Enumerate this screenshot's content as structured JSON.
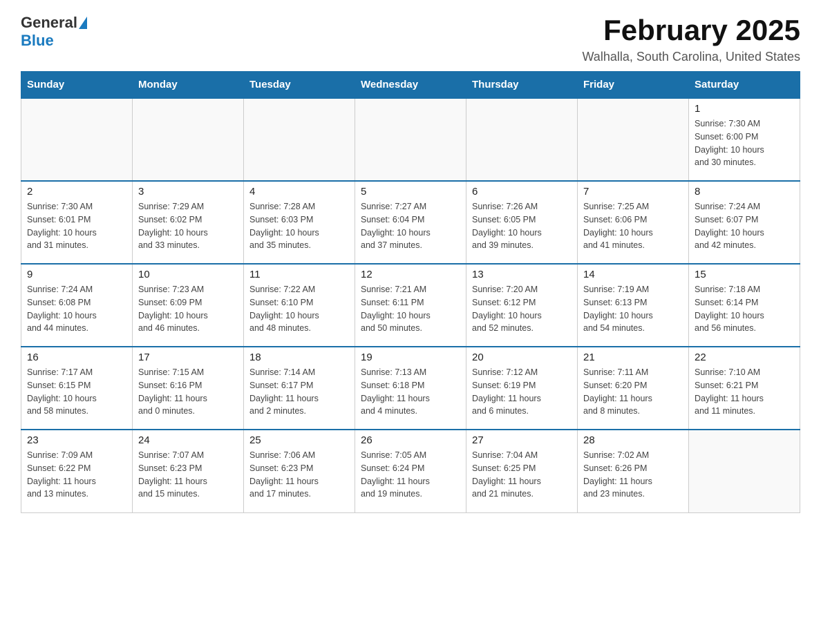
{
  "header": {
    "logo_general": "General",
    "logo_blue": "Blue",
    "month_title": "February 2025",
    "location": "Walhalla, South Carolina, United States"
  },
  "weekdays": [
    "Sunday",
    "Monday",
    "Tuesday",
    "Wednesday",
    "Thursday",
    "Friday",
    "Saturday"
  ],
  "weeks": [
    [
      {
        "day": "",
        "info": ""
      },
      {
        "day": "",
        "info": ""
      },
      {
        "day": "",
        "info": ""
      },
      {
        "day": "",
        "info": ""
      },
      {
        "day": "",
        "info": ""
      },
      {
        "day": "",
        "info": ""
      },
      {
        "day": "1",
        "info": "Sunrise: 7:30 AM\nSunset: 6:00 PM\nDaylight: 10 hours\nand 30 minutes."
      }
    ],
    [
      {
        "day": "2",
        "info": "Sunrise: 7:30 AM\nSunset: 6:01 PM\nDaylight: 10 hours\nand 31 minutes."
      },
      {
        "day": "3",
        "info": "Sunrise: 7:29 AM\nSunset: 6:02 PM\nDaylight: 10 hours\nand 33 minutes."
      },
      {
        "day": "4",
        "info": "Sunrise: 7:28 AM\nSunset: 6:03 PM\nDaylight: 10 hours\nand 35 minutes."
      },
      {
        "day": "5",
        "info": "Sunrise: 7:27 AM\nSunset: 6:04 PM\nDaylight: 10 hours\nand 37 minutes."
      },
      {
        "day": "6",
        "info": "Sunrise: 7:26 AM\nSunset: 6:05 PM\nDaylight: 10 hours\nand 39 minutes."
      },
      {
        "day": "7",
        "info": "Sunrise: 7:25 AM\nSunset: 6:06 PM\nDaylight: 10 hours\nand 41 minutes."
      },
      {
        "day": "8",
        "info": "Sunrise: 7:24 AM\nSunset: 6:07 PM\nDaylight: 10 hours\nand 42 minutes."
      }
    ],
    [
      {
        "day": "9",
        "info": "Sunrise: 7:24 AM\nSunset: 6:08 PM\nDaylight: 10 hours\nand 44 minutes."
      },
      {
        "day": "10",
        "info": "Sunrise: 7:23 AM\nSunset: 6:09 PM\nDaylight: 10 hours\nand 46 minutes."
      },
      {
        "day": "11",
        "info": "Sunrise: 7:22 AM\nSunset: 6:10 PM\nDaylight: 10 hours\nand 48 minutes."
      },
      {
        "day": "12",
        "info": "Sunrise: 7:21 AM\nSunset: 6:11 PM\nDaylight: 10 hours\nand 50 minutes."
      },
      {
        "day": "13",
        "info": "Sunrise: 7:20 AM\nSunset: 6:12 PM\nDaylight: 10 hours\nand 52 minutes."
      },
      {
        "day": "14",
        "info": "Sunrise: 7:19 AM\nSunset: 6:13 PM\nDaylight: 10 hours\nand 54 minutes."
      },
      {
        "day": "15",
        "info": "Sunrise: 7:18 AM\nSunset: 6:14 PM\nDaylight: 10 hours\nand 56 minutes."
      }
    ],
    [
      {
        "day": "16",
        "info": "Sunrise: 7:17 AM\nSunset: 6:15 PM\nDaylight: 10 hours\nand 58 minutes."
      },
      {
        "day": "17",
        "info": "Sunrise: 7:15 AM\nSunset: 6:16 PM\nDaylight: 11 hours\nand 0 minutes."
      },
      {
        "day": "18",
        "info": "Sunrise: 7:14 AM\nSunset: 6:17 PM\nDaylight: 11 hours\nand 2 minutes."
      },
      {
        "day": "19",
        "info": "Sunrise: 7:13 AM\nSunset: 6:18 PM\nDaylight: 11 hours\nand 4 minutes."
      },
      {
        "day": "20",
        "info": "Sunrise: 7:12 AM\nSunset: 6:19 PM\nDaylight: 11 hours\nand 6 minutes."
      },
      {
        "day": "21",
        "info": "Sunrise: 7:11 AM\nSunset: 6:20 PM\nDaylight: 11 hours\nand 8 minutes."
      },
      {
        "day": "22",
        "info": "Sunrise: 7:10 AM\nSunset: 6:21 PM\nDaylight: 11 hours\nand 11 minutes."
      }
    ],
    [
      {
        "day": "23",
        "info": "Sunrise: 7:09 AM\nSunset: 6:22 PM\nDaylight: 11 hours\nand 13 minutes."
      },
      {
        "day": "24",
        "info": "Sunrise: 7:07 AM\nSunset: 6:23 PM\nDaylight: 11 hours\nand 15 minutes."
      },
      {
        "day": "25",
        "info": "Sunrise: 7:06 AM\nSunset: 6:23 PM\nDaylight: 11 hours\nand 17 minutes."
      },
      {
        "day": "26",
        "info": "Sunrise: 7:05 AM\nSunset: 6:24 PM\nDaylight: 11 hours\nand 19 minutes."
      },
      {
        "day": "27",
        "info": "Sunrise: 7:04 AM\nSunset: 6:25 PM\nDaylight: 11 hours\nand 21 minutes."
      },
      {
        "day": "28",
        "info": "Sunrise: 7:02 AM\nSunset: 6:26 PM\nDaylight: 11 hours\nand 23 minutes."
      },
      {
        "day": "",
        "info": ""
      }
    ]
  ]
}
